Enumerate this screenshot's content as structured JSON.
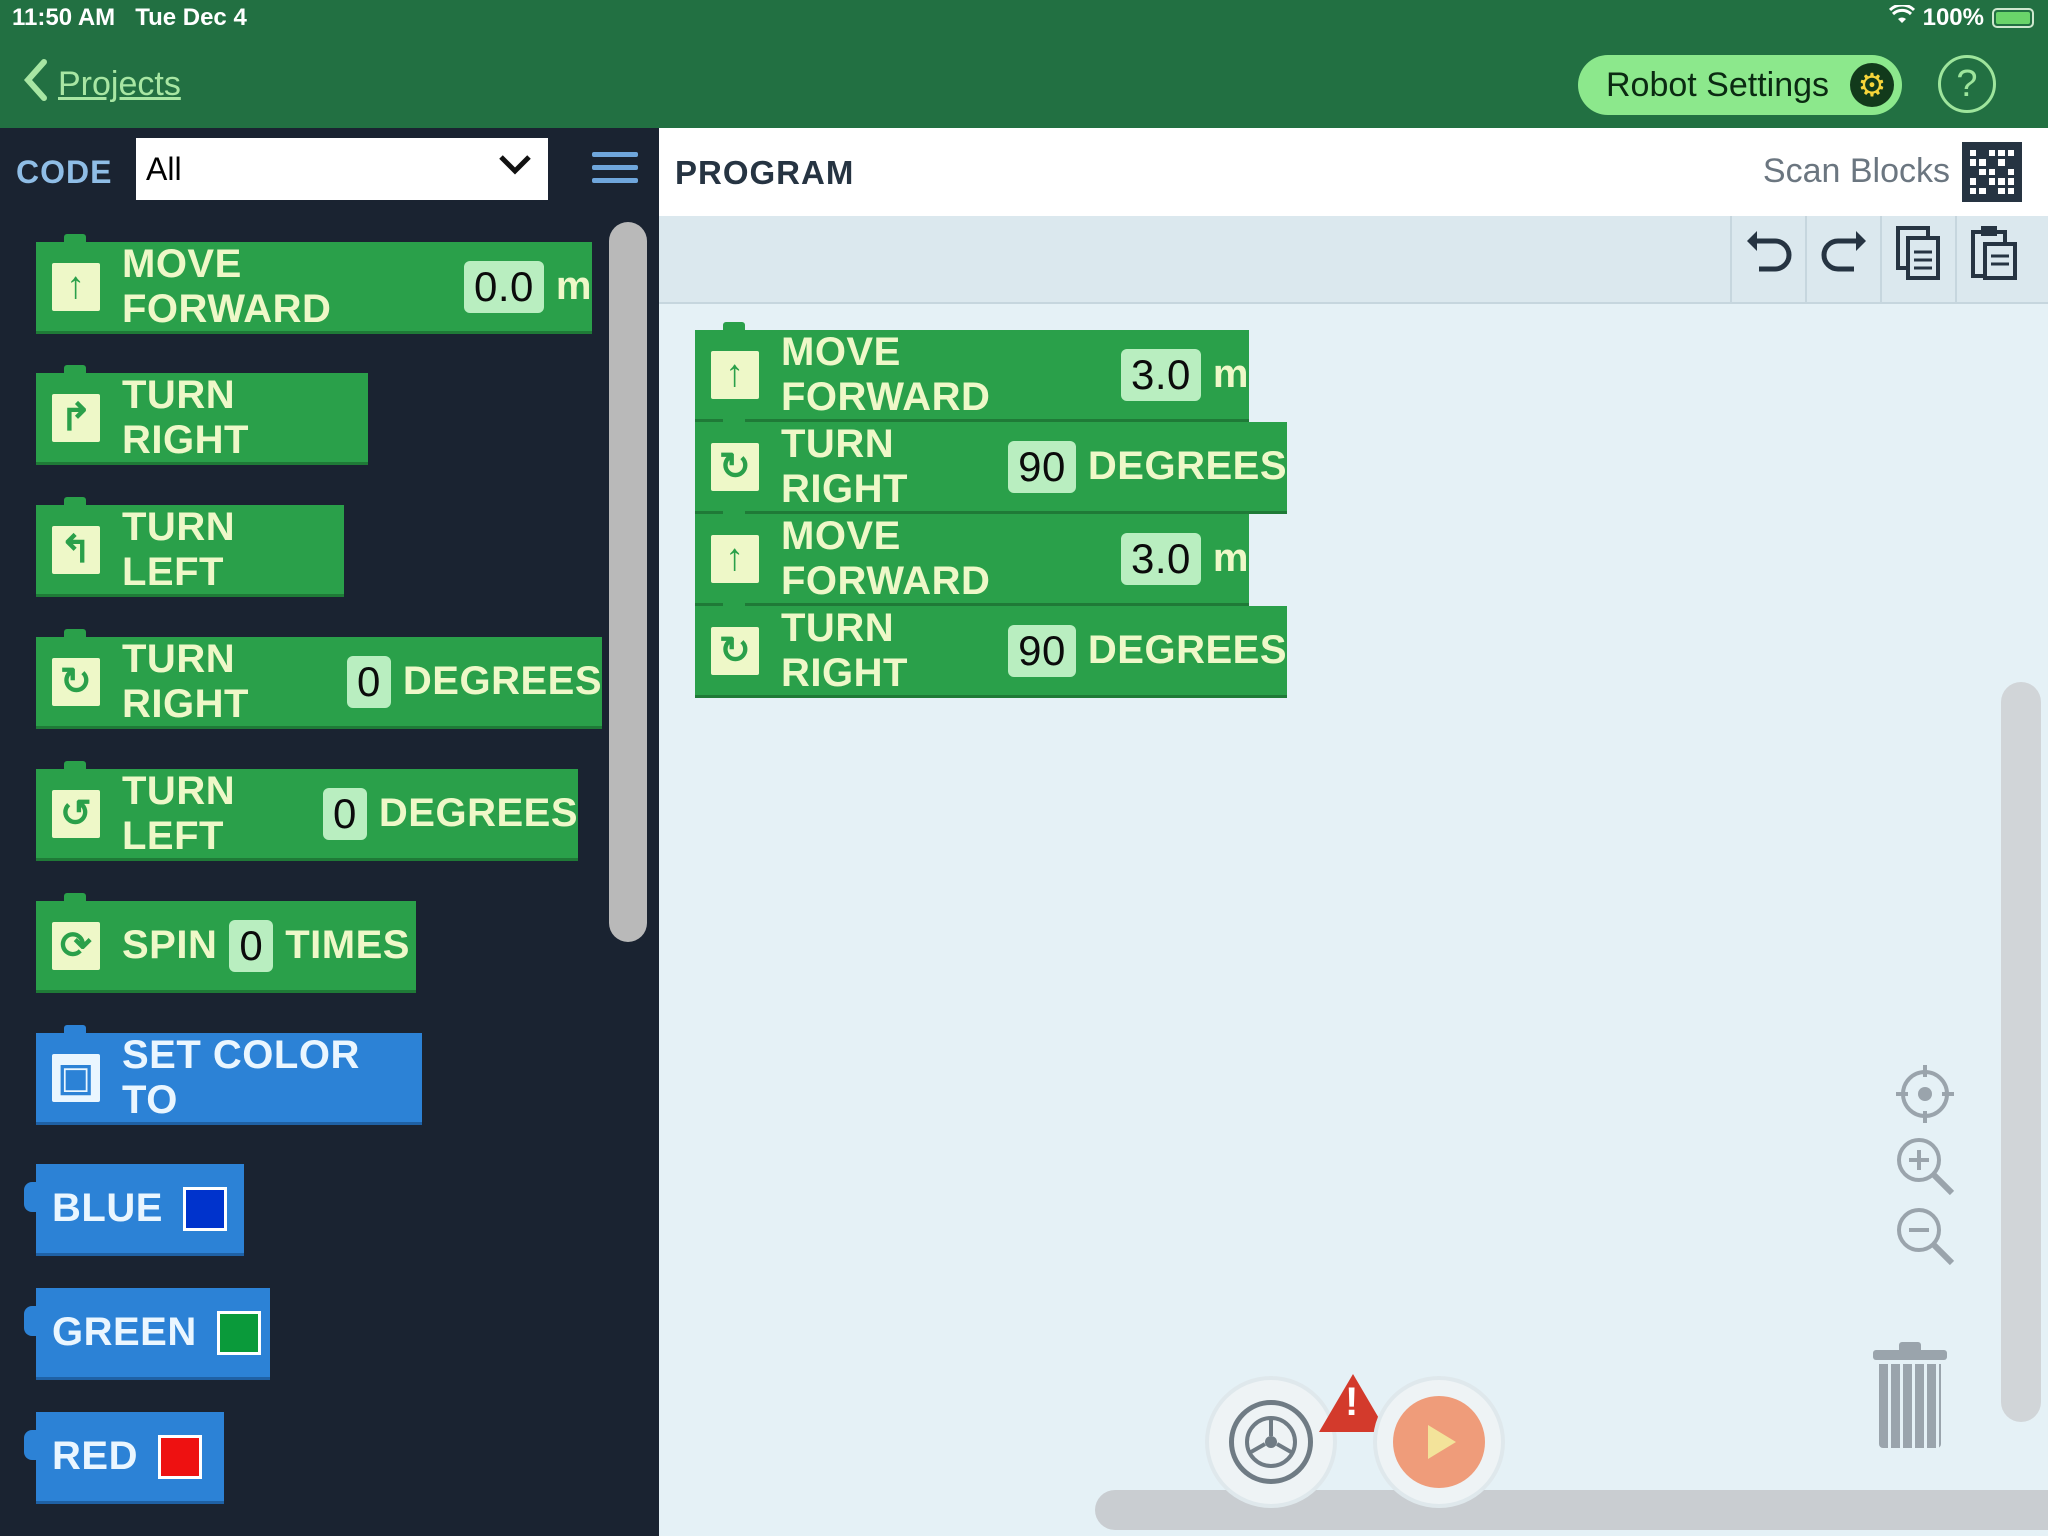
{
  "status_bar": {
    "time": "11:50 AM",
    "date": "Tue Dec 4",
    "battery": "100%"
  },
  "nav": {
    "back_label": "Projects",
    "robot_settings_label": "Robot Settings",
    "help_label": "?"
  },
  "palette": {
    "code_label": "CODE",
    "category_selected": "All",
    "blocks": [
      {
        "label": "MOVE FORWARD",
        "value": "0.0",
        "suffix": "m",
        "icon": "arrow-up-icon"
      },
      {
        "label": "TURN RIGHT",
        "icon": "turn-right-arrow-icon"
      },
      {
        "label": "TURN LEFT",
        "icon": "turn-left-arrow-icon"
      },
      {
        "label": "TURN RIGHT",
        "value": "0",
        "suffix": "DEGREES",
        "icon": "rotate-right-icon"
      },
      {
        "label": "TURN LEFT",
        "value": "0",
        "suffix": "DEGREES",
        "icon": "rotate-left-icon"
      },
      {
        "label": "SPIN",
        "value": "0",
        "suffix": "TIMES",
        "icon": "spin-icon"
      },
      {
        "label": "SET COLOR TO",
        "icon": "robot-light-icon"
      }
    ],
    "colors": [
      {
        "label": "BLUE",
        "color": "#0033cc"
      },
      {
        "label": "GREEN",
        "color": "#0a9a3a"
      },
      {
        "label": "RED",
        "color": "#ee1111"
      }
    ]
  },
  "program": {
    "title": "PROGRAM",
    "scan_label": "Scan Blocks",
    "blocks": [
      {
        "label": "MOVE FORWARD",
        "value": "3.0",
        "suffix": "m"
      },
      {
        "label": "TURN RIGHT",
        "value": "90",
        "suffix": "DEGREES"
      },
      {
        "label": "MOVE FORWARD",
        "value": "3.0",
        "suffix": "m"
      },
      {
        "label": "TURN RIGHT",
        "value": "90",
        "suffix": "DEGREES"
      }
    ]
  },
  "colors": {
    "top_bar": "#227042",
    "block_green": "#2aa04a",
    "block_blue": "#2c82d6",
    "palette_bg": "#1a2331",
    "workspace_bg": "#e5f1f6"
  }
}
